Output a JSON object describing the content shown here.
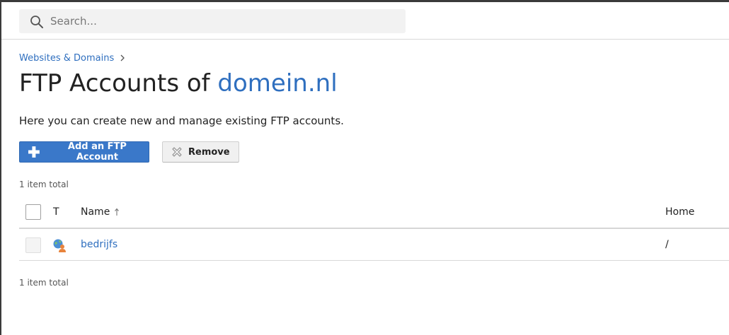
{
  "search": {
    "placeholder": "Search...",
    "value": ""
  },
  "breadcrumb": {
    "items": [
      {
        "label": "Websites & Domains"
      }
    ]
  },
  "page": {
    "title_prefix": "FTP Accounts of ",
    "title_domain": "domein.nl",
    "description": "Here you can create new and manage existing FTP accounts."
  },
  "toolbar": {
    "add_label": "Add an FTP Account",
    "remove_label": "Remove"
  },
  "list": {
    "count_label": "1 item total",
    "columns": {
      "type": "T",
      "name": "Name",
      "sort_indicator": "↑",
      "home": "Home"
    },
    "rows": [
      {
        "name": "bedrijfs",
        "home": "/",
        "type_icon": "ftp-user-icon"
      }
    ]
  },
  "colors": {
    "accent": "#2f6fbf",
    "primary_button": "#3a78c9"
  }
}
